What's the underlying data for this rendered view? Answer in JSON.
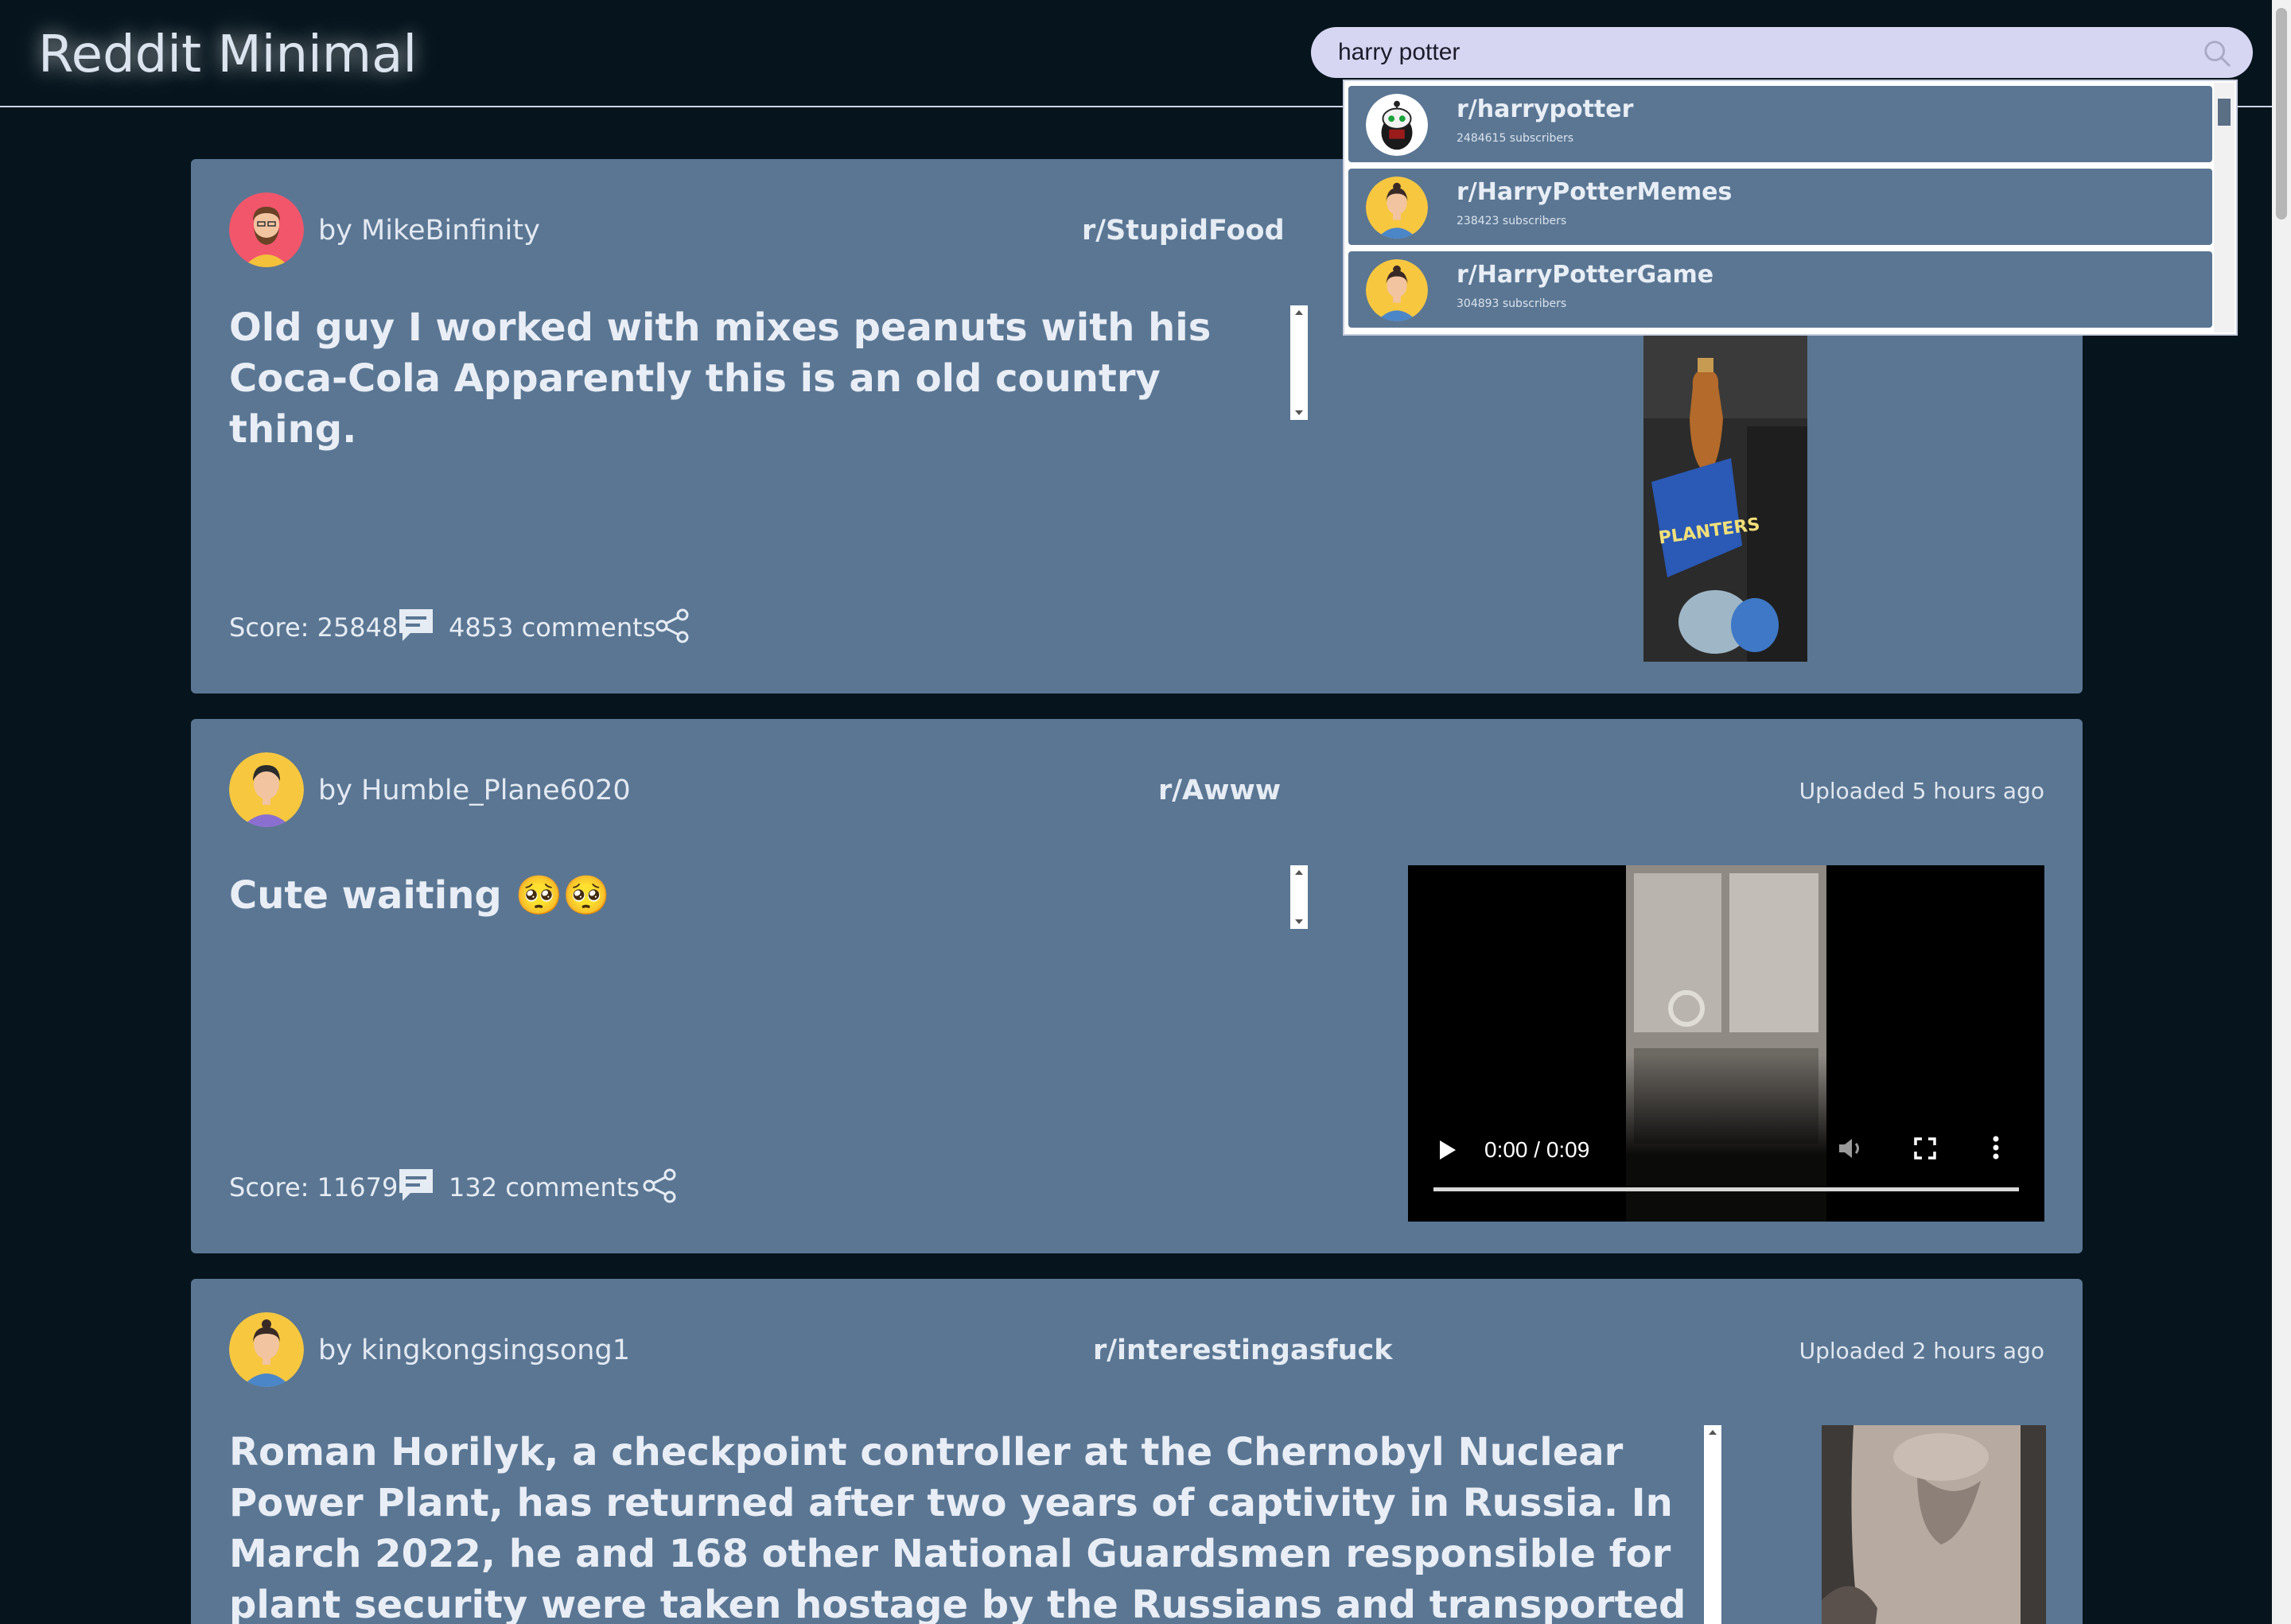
{
  "app": {
    "title": "Reddit Minimal"
  },
  "search": {
    "value": "harry potter",
    "placeholder": ""
  },
  "suggestions": [
    {
      "name": "r/harrypotter",
      "subscribers": "2484615 subscribers",
      "icon": "reddit-snoo-icon"
    },
    {
      "name": "r/HarryPotterMemes",
      "subscribers": "238423 subscribers",
      "icon": "default-avatar-icon"
    },
    {
      "name": "r/HarryPotterGame",
      "subscribers": "304893 subscribers",
      "icon": "default-avatar-icon"
    }
  ],
  "posts": [
    {
      "author": "by MikeBinfinity",
      "subreddit": "r/StupidFood",
      "uploaded": "",
      "title": "Old guy I worked with mixes peanuts with his Coca-Cola Apparently this is an old country thing.",
      "score": "Score: 25848",
      "comments": "4853 comments",
      "media": "image",
      "media_label": "PLANTERS"
    },
    {
      "author": "by Humble_Plane6020",
      "subreddit": "r/Awww",
      "uploaded": "Uploaded 5 hours ago",
      "title": "Cute waiting 🥺🥺",
      "score": "Score: 11679",
      "comments": "132 comments",
      "media": "video",
      "video_time": "0:00 / 0:09"
    },
    {
      "author": "by kingkongsingsong1",
      "subreddit": "r/interestingasfuck",
      "uploaded": "Uploaded 2 hours ago",
      "title": "Roman Horilyk, a checkpoint controller at the Chernobyl Nuclear Power Plant, has returned after two years of captivity in Russia. In March 2022, he and 168 other National Guardsmen responsible for plant security were taken hostage by the Russians and transported out of Ukraine.",
      "media": "image"
    }
  ],
  "colors": {
    "background": "#06141d",
    "card": "#5a7693",
    "search": "#d6d6f2",
    "text": "#e6ecf4"
  }
}
